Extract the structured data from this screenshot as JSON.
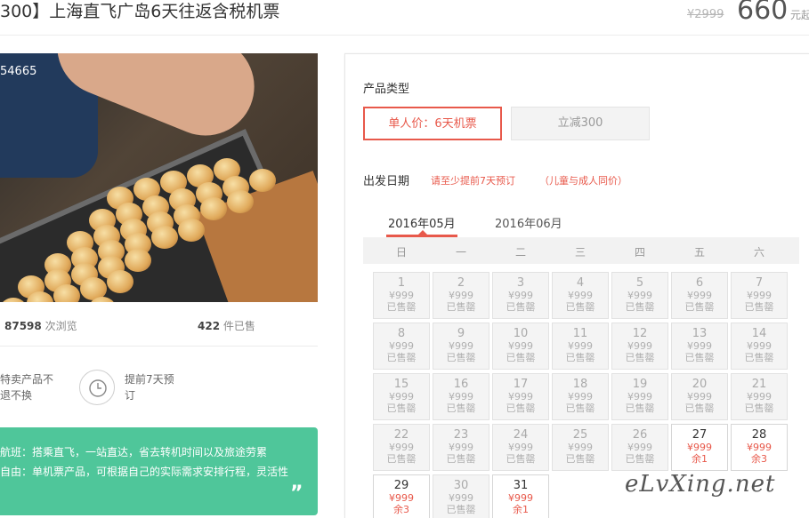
{
  "header": {
    "title": "300】上海直飞广岛6天往返含税机票",
    "original_price": "¥2999",
    "price": "660",
    "price_unit": "元起"
  },
  "gallery": {
    "counter": "54665"
  },
  "stats": {
    "views_count": "87598",
    "views_label": "次浏览",
    "sold_count": "422",
    "sold_label": "件已售"
  },
  "features": {
    "special_line1": "特卖产品不",
    "special_line2": "退不换",
    "advance_line1": "提前7天预",
    "advance_line2": "订"
  },
  "highlights": {
    "line1": "航班：搭乘直飞，一站直达，省去转机时间以及旅途劳累",
    "line2": "自由：单机票产品，可根据自己的实际需求安排行程，灵活性",
    "quote": "”"
  },
  "booking": {
    "type_label": "产品类型",
    "type_options": [
      "单人价：6天机票",
      "立减300"
    ],
    "date_label": "出发日期",
    "date_note": "请至少提前7天预订",
    "date_note2": "（儿童与成人同价）",
    "months": [
      "2016年05月",
      "2016年06月"
    ],
    "weekdays": [
      "日",
      "一",
      "二",
      "三",
      "四",
      "五",
      "六"
    ]
  },
  "calendar": {
    "days": [
      {
        "day": "1",
        "price": "¥999",
        "status": "已售罄",
        "available": false
      },
      {
        "day": "2",
        "price": "¥999",
        "status": "已售罄",
        "available": false
      },
      {
        "day": "3",
        "price": "¥999",
        "status": "已售罄",
        "available": false
      },
      {
        "day": "4",
        "price": "¥999",
        "status": "已售罄",
        "available": false
      },
      {
        "day": "5",
        "price": "¥999",
        "status": "已售罄",
        "available": false
      },
      {
        "day": "6",
        "price": "¥999",
        "status": "已售罄",
        "available": false
      },
      {
        "day": "7",
        "price": "¥999",
        "status": "已售罄",
        "available": false
      },
      {
        "day": "8",
        "price": "¥999",
        "status": "已售罄",
        "available": false
      },
      {
        "day": "9",
        "price": "¥999",
        "status": "已售罄",
        "available": false
      },
      {
        "day": "10",
        "price": "¥999",
        "status": "已售罄",
        "available": false
      },
      {
        "day": "11",
        "price": "¥999",
        "status": "已售罄",
        "available": false
      },
      {
        "day": "12",
        "price": "¥999",
        "status": "已售罄",
        "available": false
      },
      {
        "day": "13",
        "price": "¥999",
        "status": "已售罄",
        "available": false
      },
      {
        "day": "14",
        "price": "¥999",
        "status": "已售罄",
        "available": false
      },
      {
        "day": "15",
        "price": "¥999",
        "status": "已售罄",
        "available": false
      },
      {
        "day": "16",
        "price": "¥999",
        "status": "已售罄",
        "available": false
      },
      {
        "day": "17",
        "price": "¥999",
        "status": "已售罄",
        "available": false
      },
      {
        "day": "18",
        "price": "¥999",
        "status": "已售罄",
        "available": false
      },
      {
        "day": "19",
        "price": "¥999",
        "status": "已售罄",
        "available": false
      },
      {
        "day": "20",
        "price": "¥999",
        "status": "已售罄",
        "available": false
      },
      {
        "day": "21",
        "price": "¥999",
        "status": "已售罄",
        "available": false
      },
      {
        "day": "22",
        "price": "¥999",
        "status": "已售罄",
        "available": false
      },
      {
        "day": "23",
        "price": "¥999",
        "status": "已售罄",
        "available": false
      },
      {
        "day": "24",
        "price": "¥999",
        "status": "已售罄",
        "available": false
      },
      {
        "day": "25",
        "price": "¥999",
        "status": "已售罄",
        "available": false
      },
      {
        "day": "26",
        "price": "¥999",
        "status": "已售罄",
        "available": false
      },
      {
        "day": "27",
        "price": "¥999",
        "status": "余1",
        "available": true
      },
      {
        "day": "28",
        "price": "¥999",
        "status": "余3",
        "available": true
      },
      {
        "day": "29",
        "price": "¥999",
        "status": "余3",
        "available": true
      },
      {
        "day": "30",
        "price": "¥999",
        "status": "已售罄",
        "available": false
      },
      {
        "day": "31",
        "price": "¥999",
        "status": "余1",
        "available": true
      }
    ]
  },
  "watermark": "eLvXing.net",
  "colors": {
    "accent": "#e8594b",
    "highlight_green": "#4fc69a"
  }
}
